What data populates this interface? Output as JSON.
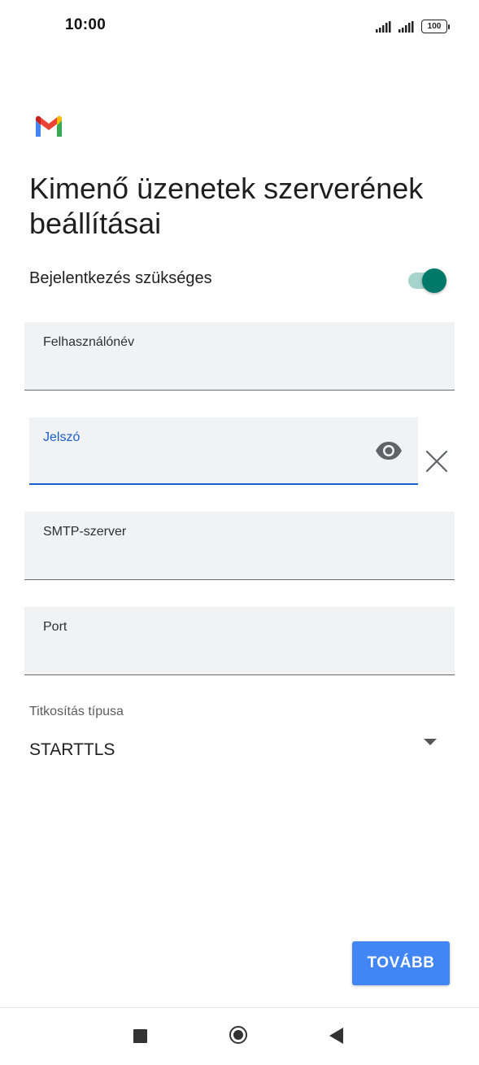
{
  "status_bar": {
    "time": "10:00",
    "battery": "100"
  },
  "app": {
    "logo_icon": "gmail-logo-icon"
  },
  "page": {
    "title": "Kimenő üzenetek szerverének beállításai"
  },
  "login_required": {
    "label": "Bejelentkezés szükséges",
    "enabled": true
  },
  "fields": {
    "username": {
      "label": "Felhasználónév",
      "value": ""
    },
    "password": {
      "label": "Jelszó",
      "value": ""
    },
    "smtp_server": {
      "label": "SMTP-szerver",
      "value": ""
    },
    "port": {
      "label": "Port",
      "value": ""
    }
  },
  "encryption": {
    "label": "Titkosítás típusa",
    "selected": "STARTTLS"
  },
  "actions": {
    "next_label": "TOVÁBB"
  },
  "colors": {
    "accent_blue": "#4285f4",
    "focus_blue": "#1a5fd0",
    "toggle_teal": "#00796b"
  }
}
